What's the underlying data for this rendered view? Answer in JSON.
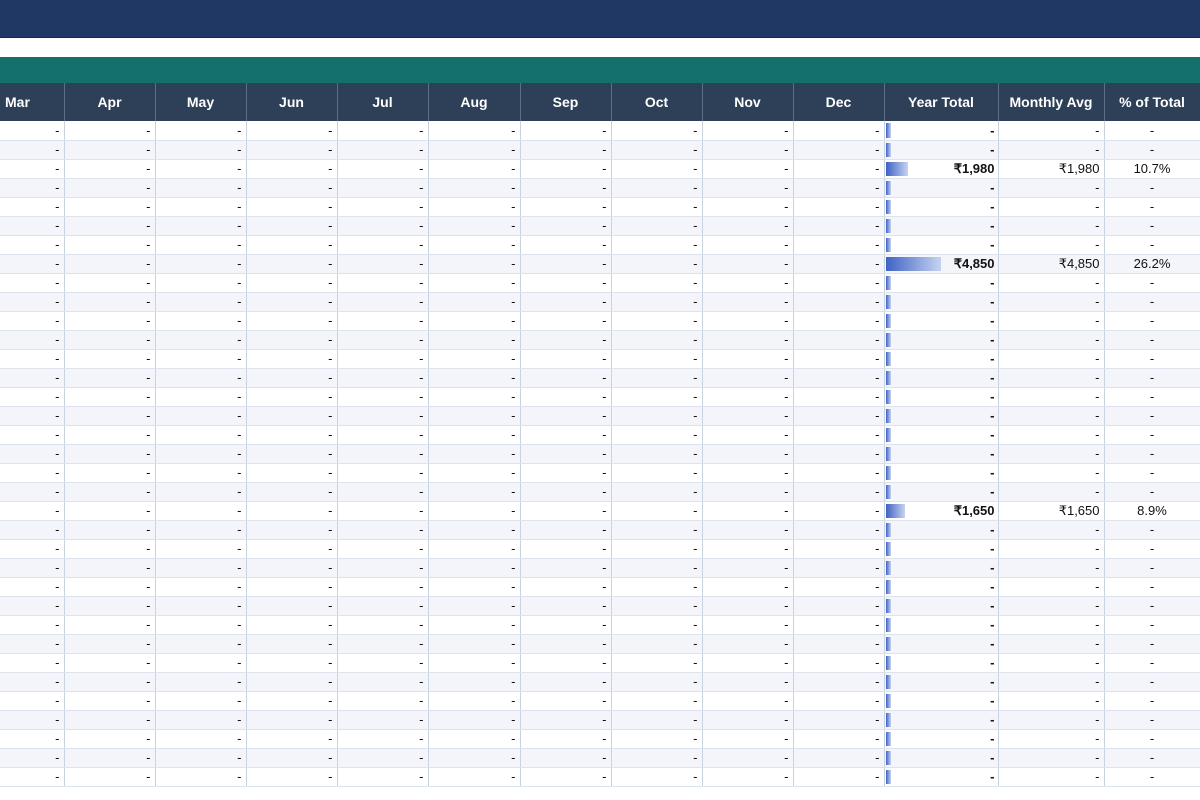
{
  "sheet": {
    "columns": [
      "Mar",
      "Apr",
      "May",
      "Jun",
      "Jul",
      "Aug",
      "Sep",
      "Oct",
      "Nov",
      "Dec",
      "Year Total",
      "Monthly Avg",
      "% of Total"
    ],
    "empty_mark": "-",
    "rows": [
      {
        "total": "-",
        "avg": "-",
        "pct": "-",
        "bar": 0
      },
      {
        "total": "-",
        "avg": "-",
        "pct": "-",
        "bar": 0
      },
      {
        "total": "₹1,980",
        "avg": "₹1,980",
        "pct": "10.7%",
        "bar": 0.107
      },
      {
        "total": "-",
        "avg": "-",
        "pct": "-",
        "bar": 0
      },
      {
        "total": "-",
        "avg": "-",
        "pct": "-",
        "bar": 0
      },
      {
        "total": "-",
        "avg": "-",
        "pct": "-",
        "bar": 0
      },
      {
        "total": "-",
        "avg": "-",
        "pct": "-",
        "bar": 0
      },
      {
        "total": "₹4,850",
        "avg": "₹4,850",
        "pct": "26.2%",
        "bar": 0.262
      },
      {
        "total": "-",
        "avg": "-",
        "pct": "-",
        "bar": 0
      },
      {
        "total": "-",
        "avg": "-",
        "pct": "-",
        "bar": 0
      },
      {
        "total": "-",
        "avg": "-",
        "pct": "-",
        "bar": 0
      },
      {
        "total": "-",
        "avg": "-",
        "pct": "-",
        "bar": 0
      },
      {
        "total": "-",
        "avg": "-",
        "pct": "-",
        "bar": 0
      },
      {
        "total": "-",
        "avg": "-",
        "pct": "-",
        "bar": 0
      },
      {
        "total": "-",
        "avg": "-",
        "pct": "-",
        "bar": 0
      },
      {
        "total": "-",
        "avg": "-",
        "pct": "-",
        "bar": 0
      },
      {
        "total": "-",
        "avg": "-",
        "pct": "-",
        "bar": 0
      },
      {
        "total": "-",
        "avg": "-",
        "pct": "-",
        "bar": 0
      },
      {
        "total": "-",
        "avg": "-",
        "pct": "-",
        "bar": 0
      },
      {
        "total": "-",
        "avg": "-",
        "pct": "-",
        "bar": 0
      },
      {
        "total": "₹1,650",
        "avg": "₹1,650",
        "pct": "8.9%",
        "bar": 0.089
      },
      {
        "total": "-",
        "avg": "-",
        "pct": "-",
        "bar": 0
      },
      {
        "total": "-",
        "avg": "-",
        "pct": "-",
        "bar": 0
      },
      {
        "total": "-",
        "avg": "-",
        "pct": "-",
        "bar": 0
      },
      {
        "total": "-",
        "avg": "-",
        "pct": "-",
        "bar": 0
      },
      {
        "total": "-",
        "avg": "-",
        "pct": "-",
        "bar": 0
      },
      {
        "total": "-",
        "avg": "-",
        "pct": "-",
        "bar": 0
      },
      {
        "total": "-",
        "avg": "-",
        "pct": "-",
        "bar": 0
      },
      {
        "total": "-",
        "avg": "-",
        "pct": "-",
        "bar": 0
      },
      {
        "total": "-",
        "avg": "-",
        "pct": "-",
        "bar": 0
      },
      {
        "total": "-",
        "avg": "-",
        "pct": "-",
        "bar": 0
      },
      {
        "total": "-",
        "avg": "-",
        "pct": "-",
        "bar": 0
      },
      {
        "total": "-",
        "avg": "-",
        "pct": "-",
        "bar": 0
      },
      {
        "total": "-",
        "avg": "-",
        "pct": "-",
        "bar": 0
      },
      {
        "total": "-",
        "avg": "-",
        "pct": "-",
        "bar": 0
      }
    ]
  },
  "colors": {
    "title_bar": "#1f3864",
    "section_bar": "#13706a",
    "header": "#2e4057",
    "databar": "#3f62c4"
  }
}
